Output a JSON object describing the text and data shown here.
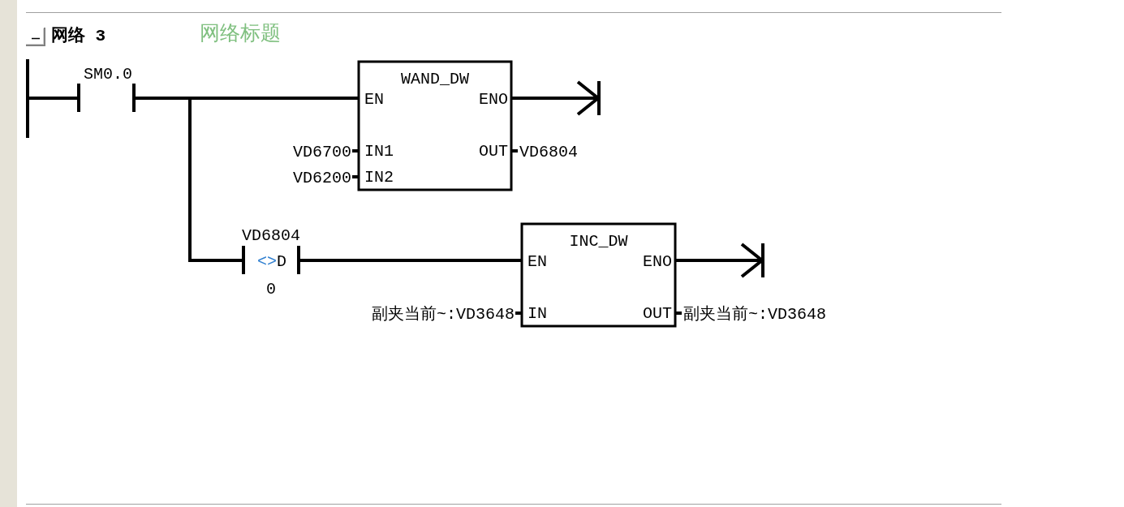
{
  "network": {
    "label": "网络 3",
    "expanded": true,
    "title": "网络标题"
  },
  "rows": [
    {
      "contact": {
        "kind": "normally_open",
        "address": "SM0.0"
      },
      "block": {
        "name": "WAND_DW",
        "enable_in": "EN",
        "enable_out": "ENO",
        "inputs": [
          {
            "pin": "IN1",
            "operand": "VD6700"
          },
          {
            "pin": "IN2",
            "operand": "VD6200"
          }
        ],
        "outputs": [
          {
            "pin": "OUT",
            "operand": "VD6804"
          }
        ]
      }
    },
    {
      "contact": {
        "kind": "compare",
        "address": "VD6804",
        "operator": "<>",
        "data_type": "D",
        "operand": "0"
      },
      "block": {
        "name": "INC_DW",
        "enable_in": "EN",
        "enable_out": "ENO",
        "inputs": [
          {
            "pin": "IN",
            "operand": "副夹当前~:VD3648"
          }
        ],
        "outputs": [
          {
            "pin": "OUT",
            "operand": "副夹当前~:VD3648"
          }
        ]
      }
    }
  ]
}
